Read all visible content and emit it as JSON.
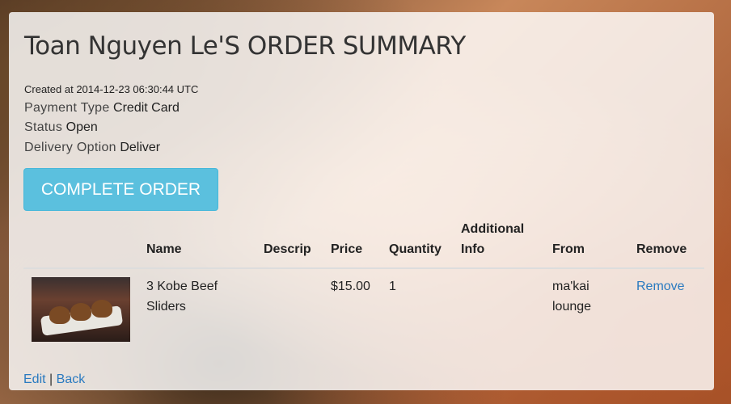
{
  "page": {
    "title": "Toan Nguyen Le'S ORDER SUMMARY"
  },
  "meta": {
    "created": "Created at 2014-12-23 06:30:44 UTC",
    "payment_label": "Payment Type",
    "payment_value": "Credit Card",
    "status_label": "Status",
    "status_value": "Open",
    "delivery_label": "Delivery Option",
    "delivery_value": "Deliver"
  },
  "actions": {
    "complete_label": "COMPLETE ORDER"
  },
  "table": {
    "headers": {
      "name": "Name",
      "descrip": "Descrip",
      "price": "Price",
      "quantity": "Quantity",
      "additional_1": "Additional",
      "additional_2": "Info",
      "from": "From",
      "remove": "Remove"
    },
    "rows": [
      {
        "image": "food-photo",
        "name_1": "3 Kobe Beef",
        "name_2": "Sliders",
        "descrip": "",
        "price": "$15.00",
        "quantity": "1",
        "additional": "",
        "from_1": "ma'kai",
        "from_2": "lounge",
        "remove_label": "Remove"
      }
    ]
  },
  "footer": {
    "edit_label": "Edit",
    "separator": "|",
    "back_label": "Back"
  },
  "colors": {
    "accent": "#5bc0de",
    "link": "#2a7ac0"
  }
}
